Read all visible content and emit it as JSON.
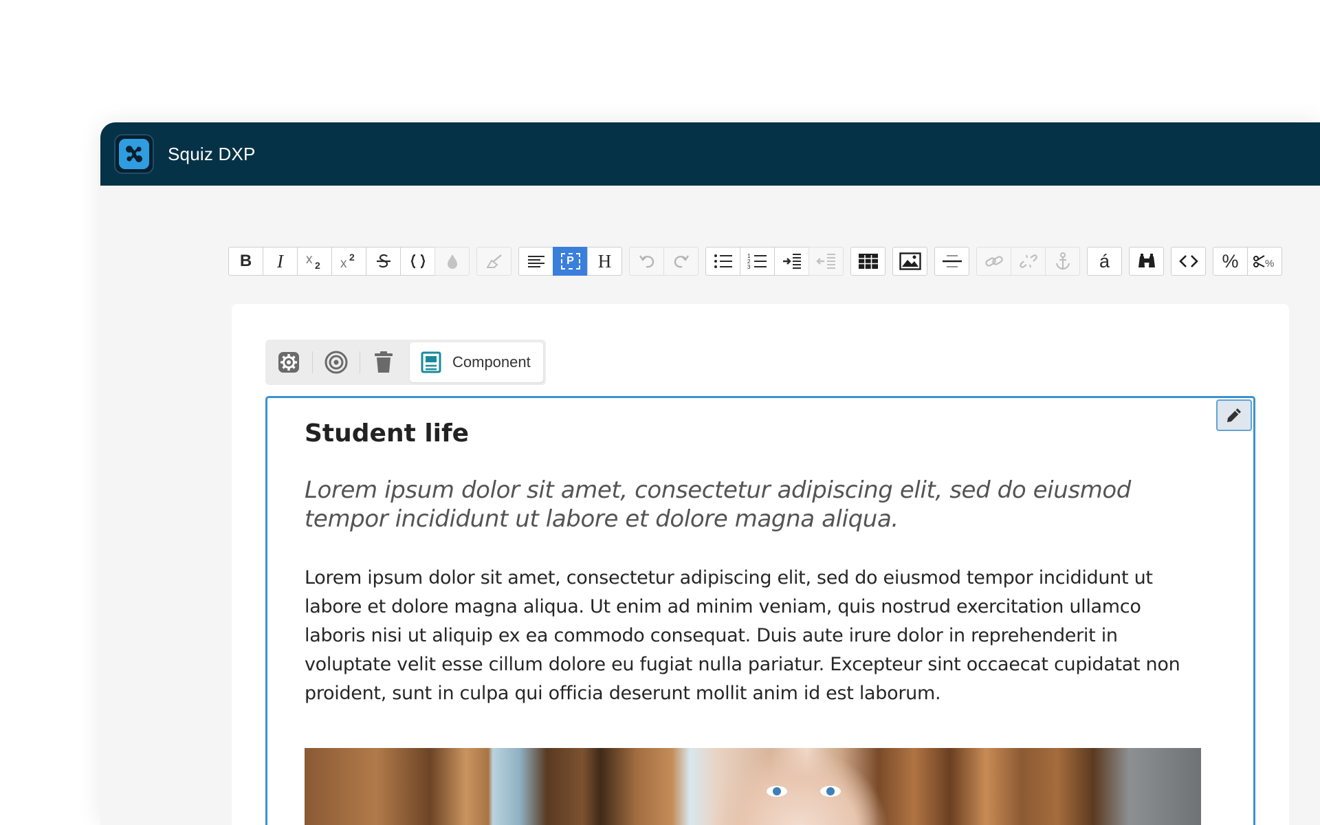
{
  "app": {
    "title": "Squiz DXP",
    "logo_icon": "squiz-logo-icon",
    "titlebar_color": "#063247",
    "accent_color": "#3b92cf"
  },
  "toolbar": {
    "groups": [
      [
        {
          "name": "bold",
          "label": "B",
          "state": "enabled"
        },
        {
          "name": "italic",
          "label": "I",
          "state": "enabled"
        },
        {
          "name": "subscript",
          "icon": "subscript-icon",
          "state": "enabled"
        },
        {
          "name": "superscript",
          "icon": "superscript-icon",
          "state": "enabled"
        },
        {
          "name": "strikethrough",
          "icon": "strikethrough-icon",
          "state": "enabled"
        },
        {
          "name": "code",
          "icon": "curly-braces-icon",
          "state": "enabled"
        },
        {
          "name": "text-color",
          "icon": "droplet-icon",
          "state": "disabled"
        }
      ],
      [
        {
          "name": "clear-formatting",
          "icon": "eraser-icon",
          "state": "disabled"
        }
      ],
      [
        {
          "name": "justify",
          "icon": "align-left-icon",
          "state": "enabled"
        },
        {
          "name": "paragraph",
          "label": "P",
          "state": "active"
        },
        {
          "name": "heading",
          "label": "H",
          "state": "enabled"
        }
      ],
      [
        {
          "name": "undo",
          "icon": "undo-icon",
          "state": "disabled"
        },
        {
          "name": "redo",
          "icon": "redo-icon",
          "state": "disabled"
        }
      ],
      [
        {
          "name": "bullet-list",
          "icon": "bullet-list-icon",
          "state": "enabled"
        },
        {
          "name": "numbered-list",
          "icon": "numbered-list-icon",
          "state": "enabled"
        },
        {
          "name": "indent",
          "icon": "indent-icon",
          "state": "enabled"
        },
        {
          "name": "outdent",
          "icon": "outdent-icon",
          "state": "disabled"
        }
      ],
      [
        {
          "name": "table",
          "icon": "table-icon",
          "state": "enabled"
        }
      ],
      [
        {
          "name": "image",
          "icon": "image-icon",
          "state": "enabled"
        }
      ],
      [
        {
          "name": "horizontal-rule",
          "icon": "horizontal-rule-icon",
          "state": "enabled"
        }
      ],
      [
        {
          "name": "link",
          "icon": "link-icon",
          "state": "disabled"
        },
        {
          "name": "unlink",
          "icon": "unlink-icon",
          "state": "disabled"
        },
        {
          "name": "anchor",
          "icon": "anchor-icon",
          "state": "disabled"
        }
      ],
      [
        {
          "name": "special-characters",
          "label": "á",
          "state": "enabled"
        }
      ],
      [
        {
          "name": "search-replace",
          "icon": "binoculars-icon",
          "state": "enabled"
        }
      ],
      [
        {
          "name": "source-code",
          "icon": "code-brackets-icon",
          "state": "enabled"
        }
      ],
      [
        {
          "name": "keyword",
          "label": "%",
          "state": "enabled"
        },
        {
          "name": "remove-keywords",
          "icon": "scissors-percent-icon",
          "state": "enabled"
        }
      ]
    ]
  },
  "component_toolbar": {
    "settings_icon": "gear-icon",
    "target_icon": "target-icon",
    "delete_icon": "trash-icon",
    "component_icon": "component-icon",
    "component_label": "Component"
  },
  "component": {
    "edit_icon": "pencil-icon",
    "heading": "Student life",
    "lead": "Lorem ipsum dolor sit amet, consectetur adipiscing elit, sed do eiusmod tempor incididunt ut labore et dolore magna aliqua.",
    "body": "Lorem ipsum dolor sit amet, consectetur adipiscing elit, sed do eiusmod tempor incididunt ut labore et dolore magna aliqua. Ut enim ad minim veniam, quis nostrud exercitation ullamco laboris nisi ut aliquip ex ea commodo consequat. Duis aute irure dolor in reprehenderit in voluptate velit esse cillum dolore eu fugiat nulla pariatur. Excepteur sint occaecat cupidatat non proident, sunt in culpa qui officia deserunt mollit anim id est laborum."
  }
}
